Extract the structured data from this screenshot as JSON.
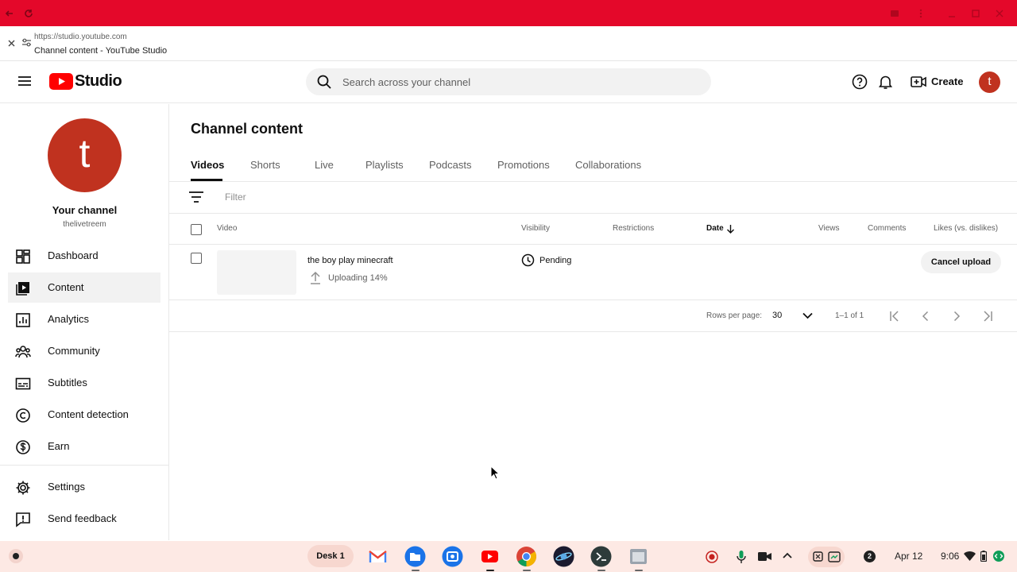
{
  "browser": {
    "url": "https://studio.youtube.com",
    "tab_title": "Channel content - YouTube Studio"
  },
  "header": {
    "logo_text": "Studio",
    "search_placeholder": "Search across your channel",
    "create_label": "Create",
    "avatar_letter": "t"
  },
  "sidebar": {
    "avatar_letter": "t",
    "channel_label": "Your channel",
    "channel_handle": "thelivetreem",
    "items": [
      {
        "label": "Dashboard",
        "icon": "dashboard-icon"
      },
      {
        "label": "Content",
        "icon": "content-icon",
        "active": true
      },
      {
        "label": "Analytics",
        "icon": "analytics-icon"
      },
      {
        "label": "Community",
        "icon": "community-icon"
      },
      {
        "label": "Subtitles",
        "icon": "subtitles-icon"
      },
      {
        "label": "Content detection",
        "icon": "copyright-icon"
      },
      {
        "label": "Earn",
        "icon": "dollar-icon"
      }
    ],
    "bottom_items": [
      {
        "label": "Settings",
        "icon": "gear-icon"
      },
      {
        "label": "Send feedback",
        "icon": "feedback-icon"
      }
    ]
  },
  "main": {
    "title": "Channel content",
    "tabs": [
      "Videos",
      "Shorts",
      "Live",
      "Playlists",
      "Podcasts",
      "Promotions",
      "Collaborations"
    ],
    "active_tab": "Videos",
    "filter_placeholder": "Filter",
    "columns": [
      "Video",
      "Visibility",
      "Restrictions",
      "Date",
      "Views",
      "Comments",
      "Likes (vs. dislikes)"
    ],
    "rows": [
      {
        "title": "the boy play minecraft",
        "status": "Uploading 14%",
        "visibility": "Pending",
        "action": "Cancel upload",
        "upload_progress": 0.14
      }
    ],
    "pagination": {
      "rows_per_page_label": "Rows per page:",
      "rows_per_page": "30",
      "range": "1–1 of 1"
    }
  },
  "shelf": {
    "desk_label": "Desk 1",
    "notification_count": "2",
    "date": "Apr 12",
    "time": "9:06",
    "colors": {
      "accent": "#e4082a",
      "shelf_bg": "#fde9e4"
    }
  }
}
